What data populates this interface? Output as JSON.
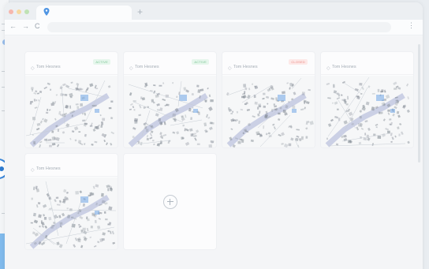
{
  "browser": {
    "new_tab_symbol": "+",
    "nav": {
      "back": "←",
      "forward": "→",
      "reload": "C"
    },
    "menu": "⋮"
  },
  "projects": [
    {
      "title": "Tom Hesnes",
      "status": "green",
      "status_label": "ACTIVE"
    },
    {
      "title": "Tom Hesnes",
      "status": "green",
      "status_label": "ACTIVE"
    },
    {
      "title": "Tom Hesnes",
      "status": "red",
      "status_label": "CLOSED"
    },
    {
      "title": "Tom Hesnes",
      "status": "none",
      "status_label": ""
    },
    {
      "title": "Tom Hesnes",
      "status": "none",
      "status_label": ""
    }
  ],
  "colors": {
    "accent": "#3a86d9",
    "badge_green": "#7cc596",
    "badge_red": "#ec8c86",
    "map_buildings": "#7f8791",
    "map_route": "#7a86c4",
    "map_water": "#6fa5e6"
  },
  "icons": {
    "add": "plus-icon",
    "card": "map-icon",
    "tab": "location-pin-icon"
  }
}
